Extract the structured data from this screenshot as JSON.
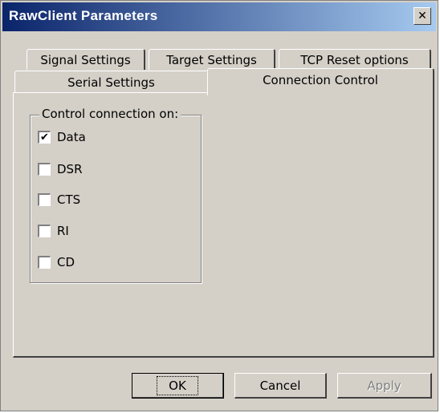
{
  "window": {
    "title": "RawClient Parameters",
    "close_glyph": "✕"
  },
  "tabs": {
    "row1": [
      {
        "label": "Signal Settings"
      },
      {
        "label": "Target Settings"
      },
      {
        "label": "TCP Reset options"
      }
    ],
    "row2": [
      {
        "label": "Serial Settings"
      },
      {
        "label": "Connection Control",
        "active": true
      }
    ]
  },
  "group": {
    "label": "Control connection on:",
    "checkboxes": [
      {
        "label": "Data",
        "checked": true
      },
      {
        "label": "DSR",
        "checked": false
      },
      {
        "label": "CTS",
        "checked": false
      },
      {
        "label": "RI",
        "checked": false
      },
      {
        "label": "CD",
        "checked": false
      }
    ]
  },
  "buttons": {
    "ok": "OK",
    "cancel": "Cancel",
    "apply": "Apply"
  },
  "check_glyph": "✔"
}
